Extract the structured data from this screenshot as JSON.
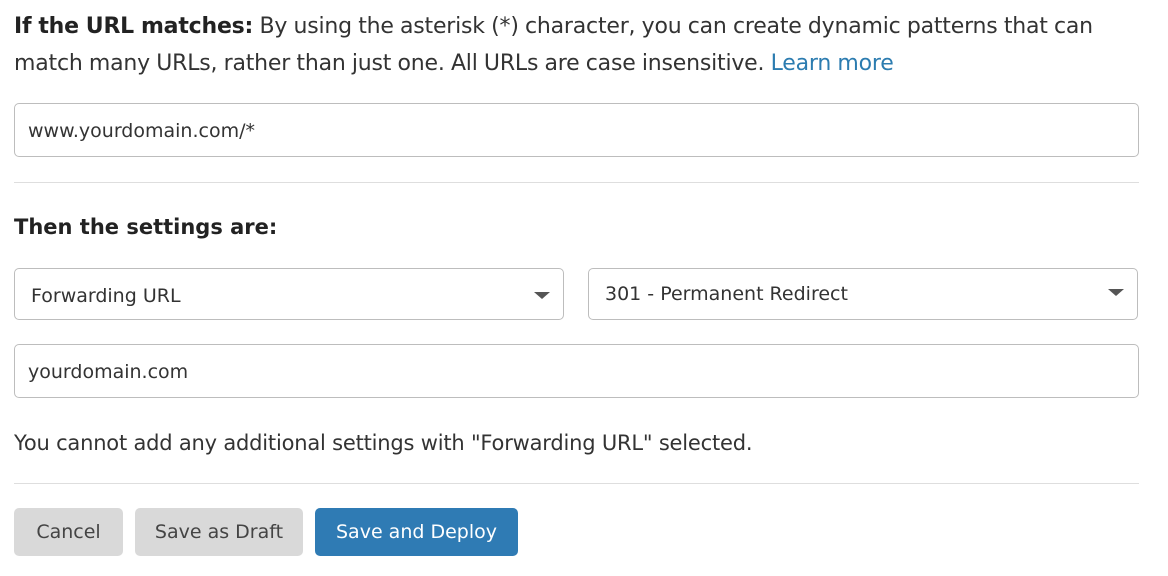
{
  "intro": {
    "label": "If the URL matches:",
    "text": " By using the asterisk (*) character, you can create dynamic patterns that can match many URLs, rather than just one. All URLs are case insensitive. ",
    "link": "Learn more"
  },
  "url_pattern": {
    "value": "www.yourdomain.com/*"
  },
  "settings": {
    "heading": "Then the settings are:",
    "setting_select": {
      "value": "Forwarding URL"
    },
    "status_select": {
      "value": "301 - Permanent Redirect"
    },
    "destination": {
      "value": "yourdomain.com"
    },
    "note": "You cannot add any additional settings with \"Forwarding URL\" selected."
  },
  "actions": {
    "cancel": "Cancel",
    "draft": "Save as Draft",
    "deploy": "Save and Deploy"
  },
  "colors": {
    "link": "#2c7cb0",
    "primary_button": "#2f7bb4",
    "secondary_button": "#d9d9d9"
  }
}
